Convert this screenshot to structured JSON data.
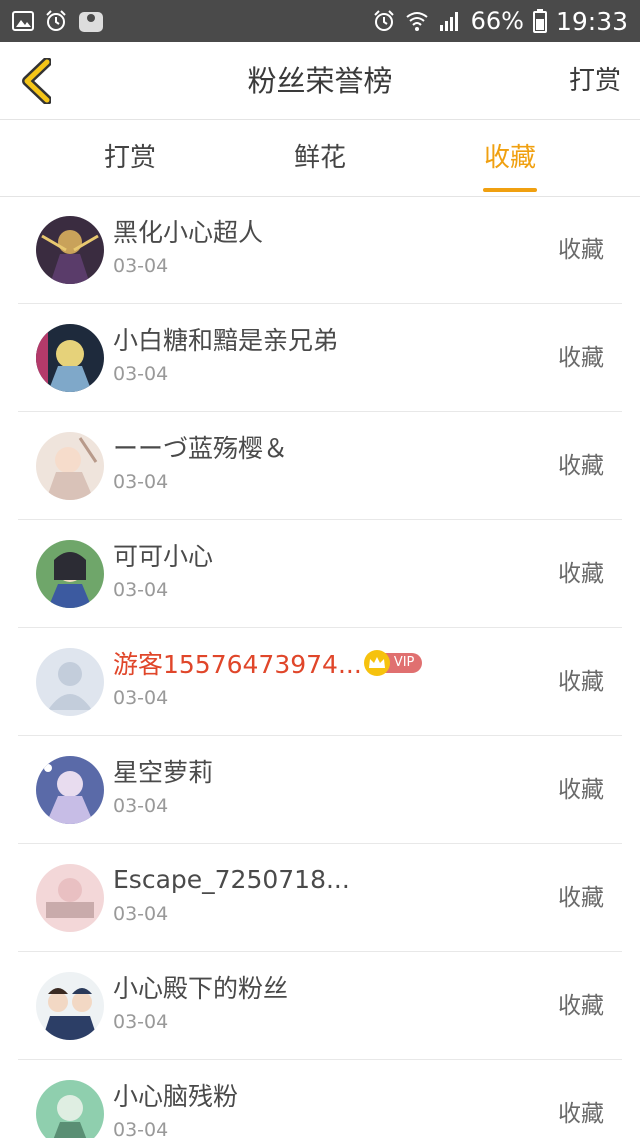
{
  "status_bar": {
    "battery_percent": "66%",
    "time": "19:33",
    "left_icons": [
      "image-icon",
      "alarm-icon",
      "app-badge-icon"
    ],
    "right_icons": [
      "alarm-icon",
      "wifi-icon",
      "signal-icon",
      "battery-icon"
    ]
  },
  "header": {
    "back_icon": "chevron-left-icon",
    "title": "粉丝荣誉榜",
    "action_label": "打赏"
  },
  "tabs": [
    {
      "label": "打赏",
      "active": false
    },
    {
      "label": "鲜花",
      "active": false
    },
    {
      "label": "收藏",
      "active": true
    }
  ],
  "colors": {
    "accent": "#f0a010",
    "vip_name": "#e0462a",
    "status_bar_bg": "#4a4a4a"
  },
  "fans": [
    {
      "name": "黑化小心超人",
      "date": "03-04",
      "action": "收藏",
      "vip": false
    },
    {
      "name": "小白糖和黯是亲兄弟",
      "date": "03-04",
      "action": "收藏",
      "vip": false
    },
    {
      "name": "ーーづ蓝殇樱＆",
      "date": "03-04",
      "action": "收藏",
      "vip": false
    },
    {
      "name": "可可小心",
      "date": "03-04",
      "action": "收藏",
      "vip": false
    },
    {
      "name": "游客15576473974...",
      "date": "03-04",
      "action": "收藏",
      "vip": true,
      "vip_label": "VIP"
    },
    {
      "name": "星空萝莉",
      "date": "03-04",
      "action": "收藏",
      "vip": false
    },
    {
      "name": "Escape_7250718...",
      "date": "03-04",
      "action": "收藏",
      "vip": false
    },
    {
      "name": "小心殿下的粉丝",
      "date": "03-04",
      "action": "收藏",
      "vip": false
    },
    {
      "name": "小心脑残粉",
      "date": "03-04",
      "action": "收藏",
      "vip": false
    }
  ]
}
